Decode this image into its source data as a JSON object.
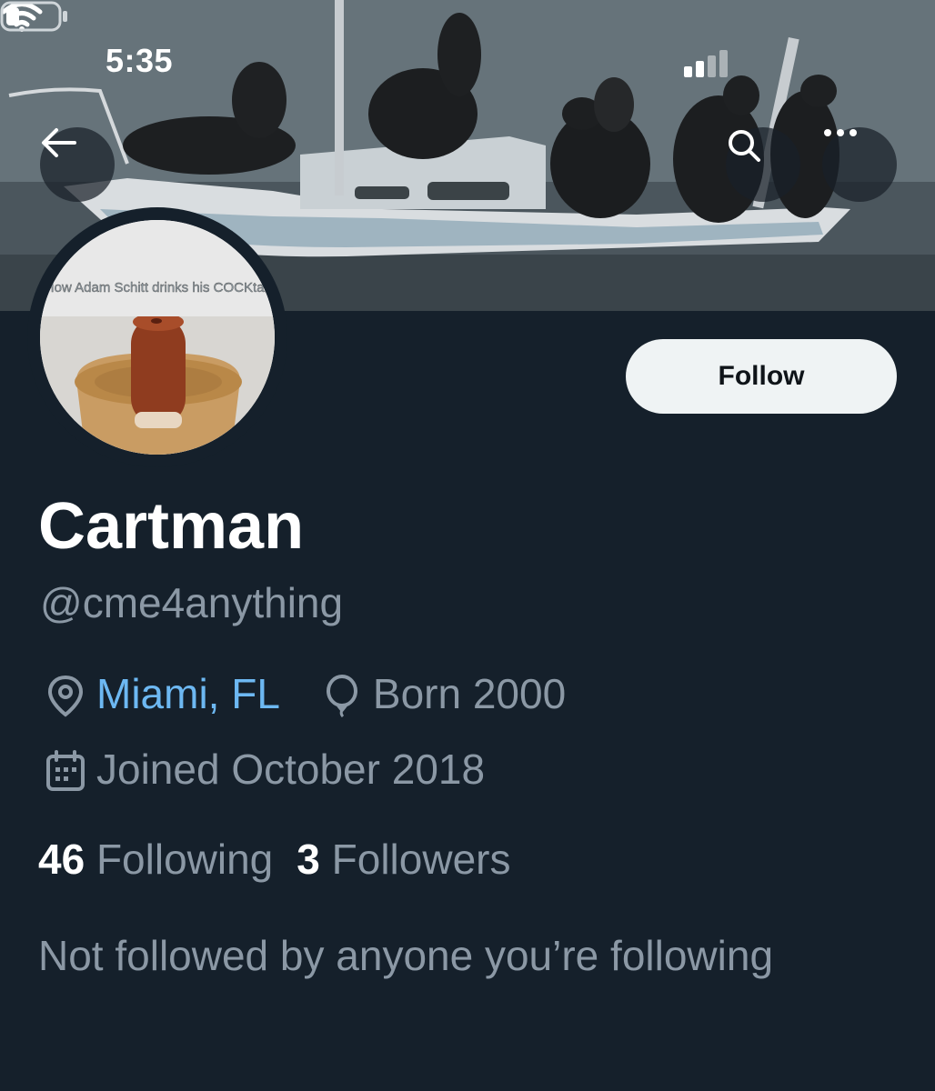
{
  "status_bar": {
    "time": "5:35"
  },
  "banner": {
    "description_icon": "sea-lions-boat-photo"
  },
  "avatar": {
    "caption": "How Adam Schitt drinks his COCKtail"
  },
  "profile": {
    "display_name": "Cartman",
    "handle": "@cme4anything",
    "location": "Miami, FL",
    "birth": "Born 2000",
    "joined": "Joined October 2018",
    "following_count": "46",
    "following_label": "Following",
    "followers_count": "3",
    "followers_label": "Followers",
    "not_followed": "Not followed by anyone you’re following"
  },
  "actions": {
    "follow_label": "Follow"
  },
  "colors": {
    "background": "#15202b",
    "accent_link": "#6db8f2",
    "secondary_text": "#8b98a5",
    "button_bg": "#eff3f4"
  },
  "icons": {
    "back": "arrow-left-icon",
    "search": "search-icon",
    "more": "more-icon",
    "location": "location-pin-icon",
    "birth": "balloon-icon",
    "joined": "calendar-icon"
  }
}
